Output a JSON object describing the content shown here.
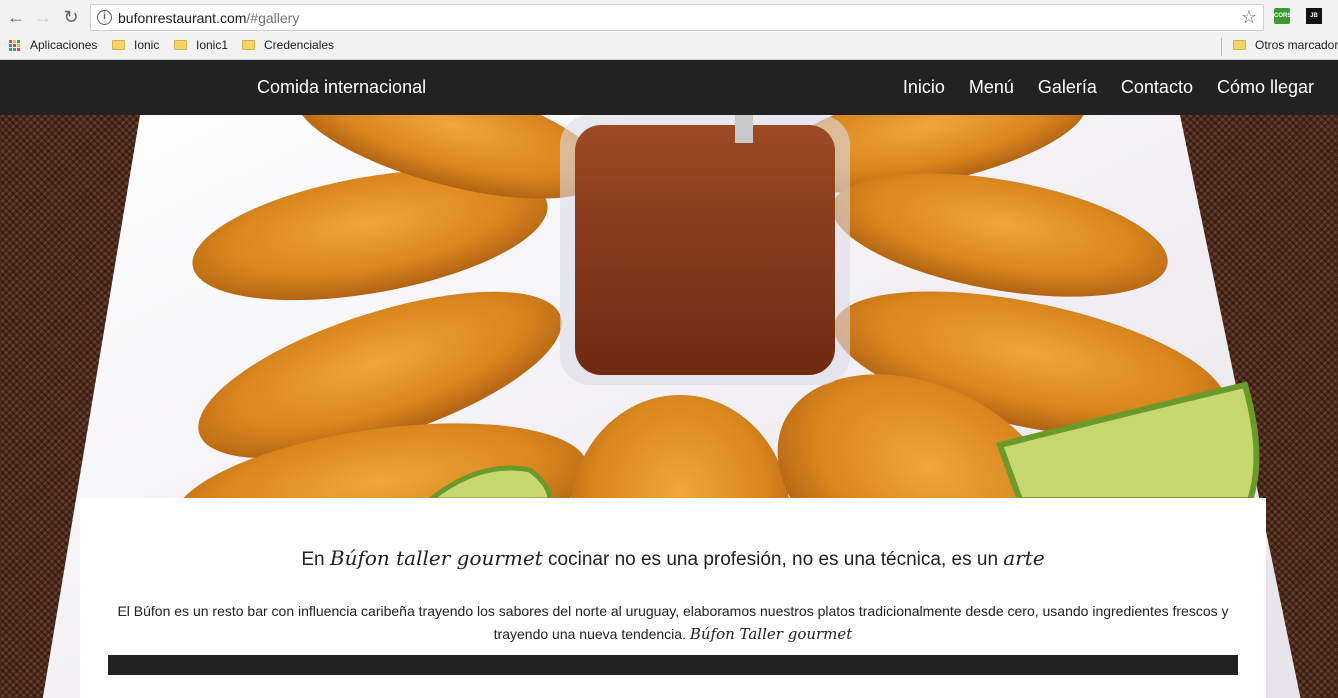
{
  "browser": {
    "url_host": "bufonrestaurant.com",
    "url_path": "/#gallery",
    "bookmarks": [
      {
        "label": "Aplicaciones",
        "icon": "apps-grid-icon"
      },
      {
        "label": "Ionic",
        "icon": "folder-icon"
      },
      {
        "label": "Ionic1",
        "icon": "folder-icon"
      },
      {
        "label": "Credenciales",
        "icon": "folder-icon"
      }
    ],
    "other_bookmarks": "Otros marcador",
    "extensions": [
      "CORS",
      "JB"
    ]
  },
  "site": {
    "brand": "Comida internacional",
    "nav": [
      "Inicio",
      "Menú",
      "Galería",
      "Contacto",
      "Cómo llegar"
    ],
    "headline": {
      "prefix": "En",
      "brand_script": "Búfon taller gourmet",
      "middle": "cocinar no es una profesión, no es una técnica, es un",
      "emphasis": "arte"
    },
    "paragraph": {
      "text": "El Búfon es un resto bar con influencia caribeña trayendo los sabores del norte al uruguay, elaboramos nuestros platos tradicionalmente desde cero, usando ingredientes frescos y trayendo una nueva tendencia.",
      "signature": "Búfon Taller gourmet"
    }
  },
  "colors": {
    "navbar": "#222222",
    "background": "#4a2a1c",
    "empanada": "#d9861e",
    "sauce": "#8a3a1a",
    "lime": "#c8d870"
  }
}
